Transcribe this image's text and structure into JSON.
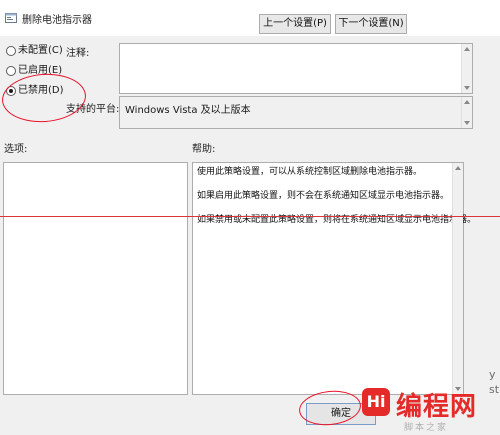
{
  "window": {
    "title": "删除电池指示器"
  },
  "nav": {
    "prev_label": "上一个设置(P)",
    "next_label": "下一个设置(N)"
  },
  "state": {
    "options": [
      {
        "label": "未配置(C)",
        "checked": false
      },
      {
        "label": "已启用(E)",
        "checked": false
      },
      {
        "label": "已禁用(D)",
        "checked": true
      }
    ]
  },
  "comment": {
    "label": "注释:",
    "value": ""
  },
  "supported": {
    "label": "支持的平台:",
    "value": "Windows Vista 及以上版本"
  },
  "options_pane": {
    "label": "选项:"
  },
  "help_pane": {
    "label": "帮助:",
    "paragraphs": [
      "使用此策略设置，可以从系统控制区域删除电池指示器。",
      "如果启用此策略设置，则不会在系统通知区域显示电池指示器。",
      "如果禁用或未配置此策略设置，则将在系统通知区域显示电池指示器。"
    ]
  },
  "footer": {
    "ok_label": "确定"
  },
  "side_text": [
    "y",
    "st"
  ],
  "watermark": {
    "logo_letter": "Hi",
    "brand": "编程网",
    "sub": "脚本之家"
  },
  "colors": {
    "annotation": "#e8132b",
    "brand": "#e52a2a"
  }
}
